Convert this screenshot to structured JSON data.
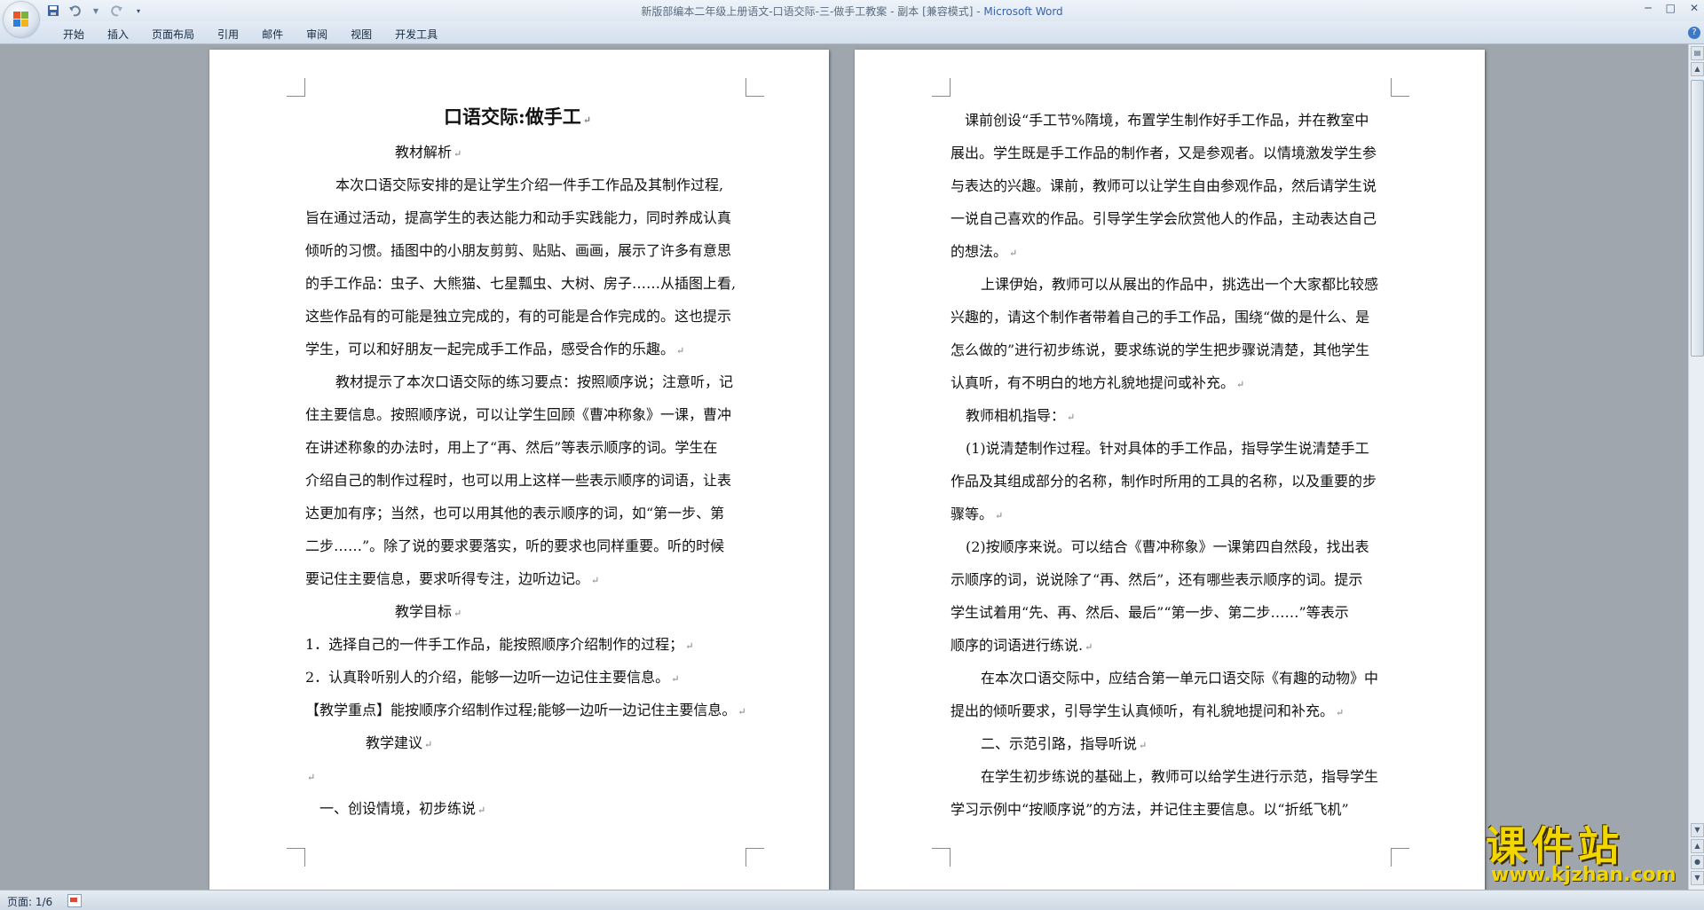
{
  "window": {
    "title_main": "新版部编本二年级上册语文-口语交际-三-做手工教案 - 副本 [兼容模式] - ",
    "title_app": "Microsoft Word"
  },
  "qat": {
    "save_icon": "save-icon",
    "undo_icon": "undo-icon",
    "redo_icon": "redo-icon"
  },
  "ribbon": {
    "tabs": [
      "开始",
      "插入",
      "页面布局",
      "引用",
      "邮件",
      "审阅",
      "视图",
      "开发工具"
    ]
  },
  "page1": {
    "title": "口语交际:做手工",
    "lines": [
      "教材解析",
      "本次口语交际安排的是让学生介绍一件手工作品及其制作过程,",
      "旨在通过活动，提高学生的表达能力和动手实践能力，同时养成认真",
      "倾听的习惯。插图中的小朋友剪剪、贴贴、画画，展示了许多有意思",
      "的手工作品：虫子、大熊猫、七星瓢虫、大树、房子……从插图上看,",
      "这些作品有的可能是独立完成的，有的可能是合作完成的。这也提示",
      "学生，可以和好朋友一起完成手工作品，感受合作的乐趣。",
      "教材提示了本次口语交际的练习要点：按照顺序说；注意听，记",
      "住主要信息。按照顺序说，可以让学生回顾《曹冲称象》一课，曹冲",
      "在讲述称象的办法时，用上了“再、然后”等表示顺序的词。学生在",
      "介绍自己的制作过程时，也可以用上这样一些表示顺序的词语，让表",
      "达更加有序；当然，也可以用其他的表示顺序的词，如“第一步、第",
      "二步……”。除了说的要求要落实，听的要求也同样重要。听的时候",
      "要记住主要信息，要求听得专注，边听边记。",
      "教学目标",
      "1．选择自己的一件手工作品，能按照顺序介绍制作的过程；",
      "2．认真聆听别人的介绍，能够一边听一边记住主要信息。",
      "【教学重点】能按顺序介绍制作过程;能够一边听一边记住主要信息。",
      "教学建议",
      "",
      "一、创设情境，初步练说"
    ]
  },
  "page2": {
    "lines": [
      "课前创设“手工节%隋境，布置学生制作好手工作品，并在教室中",
      "展出。学生既是手工作品的制作者，又是参观者。以情境激发学生参",
      "与表达的兴趣。课前，教师可以让学生自由参观作品，然后请学生说",
      "一说自己喜欢的作品。引导学生学会欣赏他人的作品，主动表达自己",
      "的想法。",
      "上课伊始，教师可以从展出的作品中，挑选出一个大家都比较感",
      "兴趣的，请这个制作者带着自己的手工作品，围绕“做的是什么、是",
      "怎么做的”进行初步练说，要求练说的学生把步骤说清楚，其他学生",
      "认真听，有不明白的地方礼貌地提问或补充。",
      "教师相机指导：",
      "(1)说清楚制作过程。针对具体的手工作品，指导学生说清楚手工",
      "作品及其组成部分的名称，制作时所用的工具的名称，以及重要的步",
      "骤等。",
      "(2)按顺序来说。可以结合《曹冲称象》一课第四自然段，找出表",
      "示顺序的词，说说除了“再、然后”，还有哪些表示顺序的词。提示",
      "学生试着用“先、再、然后、最后”“第一步、第二步……”等表示",
      "顺序的词语进行练说.",
      "在本次口语交际中，应结合第一单元口语交际《有趣的动物》中",
      "提出的倾听要求，引导学生认真倾听，有礼貌地提问和补充。",
      "二、示范引路，指导听说",
      "在学生初步练说的基础上，教师可以给学生进行示范，指导学生",
      "学习示例中“按顺序说”的方法，并记住主要信息。以“折纸飞机”"
    ]
  },
  "status": {
    "page": "页面: 1/6"
  },
  "watermark": {
    "text": "课件站",
    "url": "www.kjzhan.com"
  },
  "colors": {
    "title_brand": "#3a63a8",
    "watermark": "#f2d600"
  }
}
